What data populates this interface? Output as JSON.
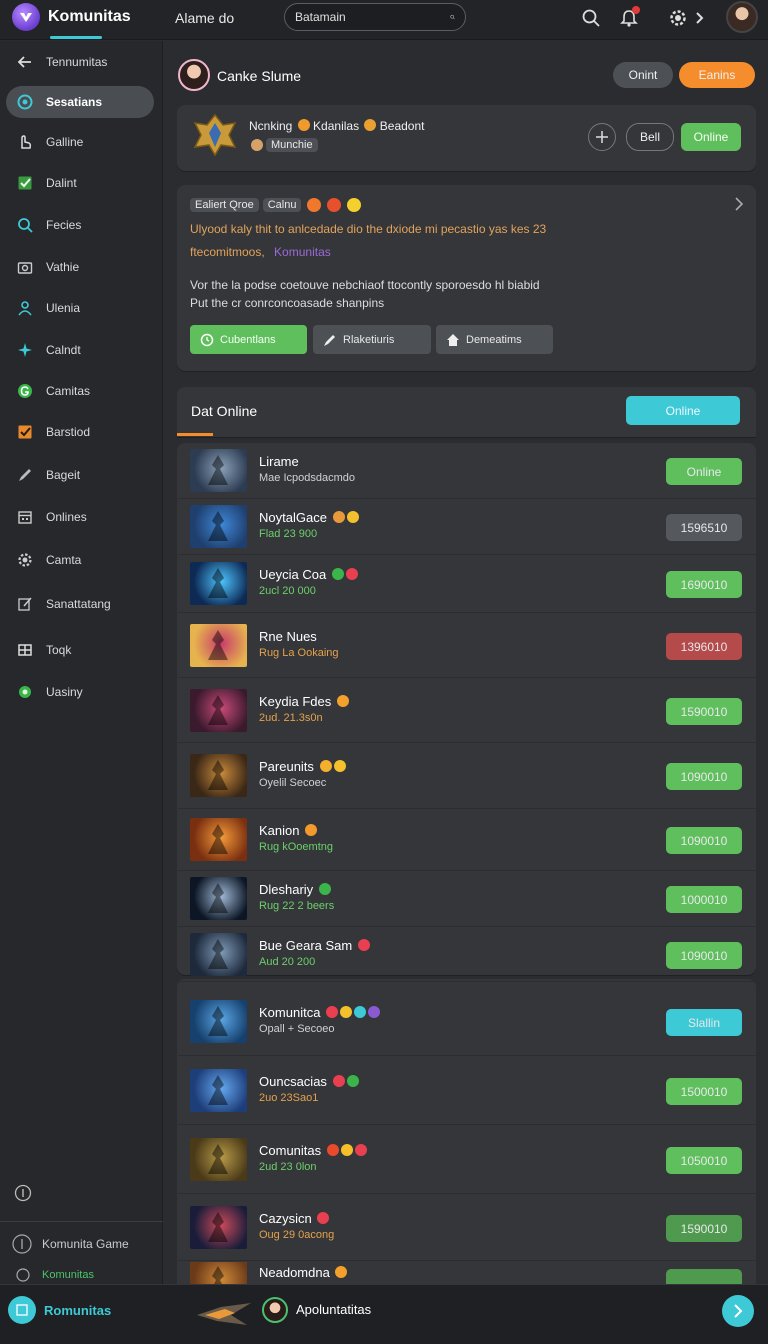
{
  "app": {
    "title": "Komunitas",
    "top_link": "Alame do",
    "search_value": "Batamain"
  },
  "sidebar": {
    "items": [
      {
        "label": "Tennumitas",
        "icon": "back-arrow-icon"
      },
      {
        "label": "Sesatians",
        "icon": "target-icon",
        "active": true
      },
      {
        "label": "Galline",
        "icon": "hand-pointer-icon"
      },
      {
        "label": "Dalint",
        "icon": "checkbox-icon"
      },
      {
        "label": "Fecies",
        "icon": "search-icon"
      },
      {
        "label": "Vathie",
        "icon": "camera-icon"
      },
      {
        "label": "Ulenia",
        "icon": "user-icon"
      },
      {
        "label": "Calndt",
        "icon": "sparkle-icon"
      },
      {
        "label": "Camitas",
        "icon": "g-circle-icon"
      },
      {
        "label": "Barstiod",
        "icon": "orange-check-icon"
      },
      {
        "label": "Bageit",
        "icon": "pen-icon"
      },
      {
        "label": "Onlines",
        "icon": "calendar-icon"
      },
      {
        "label": "Camta",
        "icon": "gear-icon"
      },
      {
        "label": "Sanattatang",
        "icon": "edit-icon"
      },
      {
        "label": "Toqk",
        "icon": "grid-icon"
      },
      {
        "label": "Uasiny",
        "icon": "green-dot-icon"
      }
    ],
    "footer_item_1": "Komunita Game",
    "footer_item_2": "Komunitas"
  },
  "profile": {
    "name": "Canke Slume",
    "btn_secondary": "Onint",
    "btn_primary": "Eanins"
  },
  "rank_card": {
    "line1_a": "Ncnking",
    "line1_b": "Kdanilas",
    "line1_c": "Beadont",
    "tag": "Munchie",
    "btn_bell": "Bell",
    "btn_online": "Online"
  },
  "post_card": {
    "tag1": "Ealiert Qroe",
    "tag2": "Calnu",
    "line1": "Ulyood kaly thit to anlcedade dio the dxiode mi pecastio yas kes 23",
    "link1": "ftecomitmoos,",
    "link2": "Komunitas",
    "body1": "Vor the la podse coetouve nebchiaof ttocontly sporoesdo hl biabid",
    "body2": "Put the cr conrconcoasade shanpins",
    "btn1": "Cubentlans",
    "btn2": "Rlaketiuris",
    "btn3": "Demeatims"
  },
  "online_section": {
    "title": "Dat Online",
    "button": "Online"
  },
  "rows": [
    {
      "title": "Lirame",
      "sub": "Mae Icpodsdacmdo",
      "sub_color": "#cfd2d5",
      "btn": "Online",
      "btn_color": "#5fbf5d",
      "thumb": [
        "#2c3c52",
        "#8aa0b8"
      ]
    },
    {
      "title": "NoytalGace",
      "sub": "Flad 23 900",
      "sub_color": "#6cd06a",
      "btn": "1596510",
      "btn_color": "#55585d",
      "thumb": [
        "#1f3f6e",
        "#3e88d8"
      ]
    },
    {
      "title": "Ueycia Coa",
      "sub": "2ucl 20 000",
      "sub_color": "#6cd06a",
      "btn": "1690010",
      "btn_color": "#5fbf5d",
      "thumb": [
        "#0d2a55",
        "#4ec4ff"
      ]
    },
    {
      "title": "Rne Nues",
      "sub": "Rug La Ookaing",
      "sub_color": "#e5a24c",
      "btn": "1396010",
      "btn_color": "#b54a4a",
      "thumb": [
        "#e6b34e",
        "#c73c6a"
      ]
    },
    {
      "title": "Keydia Fdes",
      "sub": "2ud. 21.3s0n",
      "sub_color": "#e5a24c",
      "btn": "1590010",
      "btn_color": "#5fbf5d",
      "thumb": [
        "#3b1a2e",
        "#c84a78"
      ]
    },
    {
      "title": "Pareunits",
      "sub": "Oyelil Secoec",
      "sub_color": "#cfd2d5",
      "btn": "1090010",
      "btn_color": "#5fbf5d",
      "thumb": [
        "#3a2716",
        "#c98a3c"
      ]
    },
    {
      "title": "Kanion",
      "sub": "Rug kOoemtng",
      "sub_color": "#6cd06a",
      "btn": "1090010",
      "btn_color": "#5fbf5d",
      "thumb": [
        "#7a2f10",
        "#f59a3a"
      ]
    },
    {
      "title": "Dleshariy",
      "sub": "Rug 22 2 beers",
      "sub_color": "#6cd06a",
      "btn": "1000010",
      "btn_color": "#5fbf5d",
      "thumb": [
        "#0c1624",
        "#9fb8d6"
      ]
    },
    {
      "title": "Bue Geara Sam",
      "sub": "Aud 20 200",
      "sub_color": "#6cd06a",
      "btn": "1090010",
      "btn_color": "#5fbf5d",
      "thumb": [
        "#1e2a3c",
        "#7f9ab8"
      ]
    },
    {
      "title": "Komunitca",
      "sub": "Opall + Secoeo",
      "sub_color": "#cfd2d5",
      "btn": "Slallin",
      "btn_color": "#3ec9d6",
      "thumb": [
        "#16416e",
        "#5aa6e6"
      ]
    },
    {
      "title": "Ouncsacias",
      "sub": "2uo 23Sao1",
      "sub_color": "#e5a24c",
      "btn": "1500010",
      "btn_color": "#5fbf5d",
      "thumb": [
        "#1e3e7a",
        "#64a8f0"
      ]
    },
    {
      "title": "Comunitas",
      "sub": "2ud 23 0lon",
      "sub_color": "#6cd06a",
      "btn": "1050010",
      "btn_color": "#5fbf5d",
      "thumb": [
        "#4a3a18",
        "#b89a48"
      ]
    },
    {
      "title": "Cazysicn",
      "sub": "Oug 29 0acong",
      "sub_color": "#e5a24c",
      "btn": "1590010",
      "btn_color": "#4f9a4e",
      "thumb": [
        "#1a1d3a",
        "#cc4a5a"
      ]
    },
    {
      "title": "Neadomdna",
      "sub": "",
      "sub_color": "#cfd2d5",
      "btn": "",
      "btn_color": "#4f9a4e",
      "thumb": [
        "#6b3a18",
        "#d08a3a"
      ]
    }
  ],
  "bottombar": {
    "left_label": "Romunitas",
    "center_label": "Apoluntatitas"
  }
}
